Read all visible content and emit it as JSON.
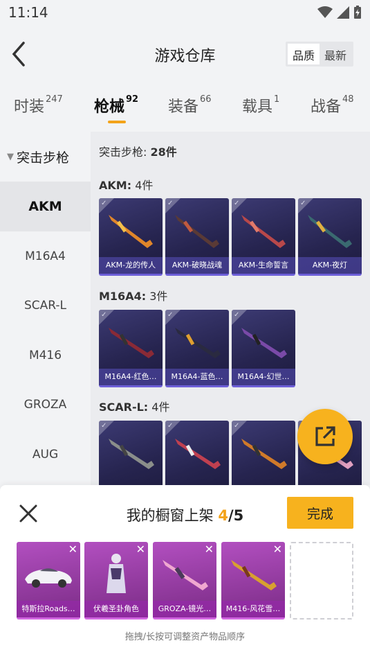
{
  "status_bar": {
    "time": "11:14"
  },
  "header": {
    "title": "游戏仓库",
    "sort_options": [
      "品质",
      "最新"
    ]
  },
  "tabs": [
    {
      "label": "时装",
      "count": "247"
    },
    {
      "label": "枪械",
      "count": "92"
    },
    {
      "label": "装备",
      "count": "66"
    },
    {
      "label": "载具",
      "count": "1"
    },
    {
      "label": "战备",
      "count": "48"
    }
  ],
  "sidebar": {
    "category": "突击步枪",
    "items": [
      "AKM",
      "M16A4",
      "SCAR-L",
      "M416",
      "GROZA",
      "AUG"
    ]
  },
  "main": {
    "summary_label": "突击步枪:",
    "summary_count": "28件",
    "sections": [
      {
        "name": "AKM:",
        "count": "4件",
        "items": [
          "AKM-龙的传人",
          "AKM-破晓战魂",
          "AKM-生命誓言",
          "AKM-夜灯"
        ]
      },
      {
        "name": "M16A4:",
        "count": "3件",
        "items": [
          "M16A4-红色…",
          "M16A4-蓝色…",
          "M16A4-幻世…"
        ]
      },
      {
        "name": "SCAR-L:",
        "count": "4件",
        "items": [
          "",
          "",
          "",
          ""
        ]
      }
    ]
  },
  "sheet": {
    "title": "我的橱窗上架",
    "current": "4",
    "separator": "/",
    "total": "5",
    "done_label": "完成",
    "selected": [
      "特斯拉Roads…",
      "伏羲圣卦角色",
      "GROZA-镜光…",
      "M416-风花雪…"
    ],
    "hint": "拖拽/长按可调整资产物品顺序"
  },
  "colors": {
    "accent": "#f7b21e",
    "card_bg": "#2c2a5c",
    "selected_bg": "#9a3aa8"
  }
}
